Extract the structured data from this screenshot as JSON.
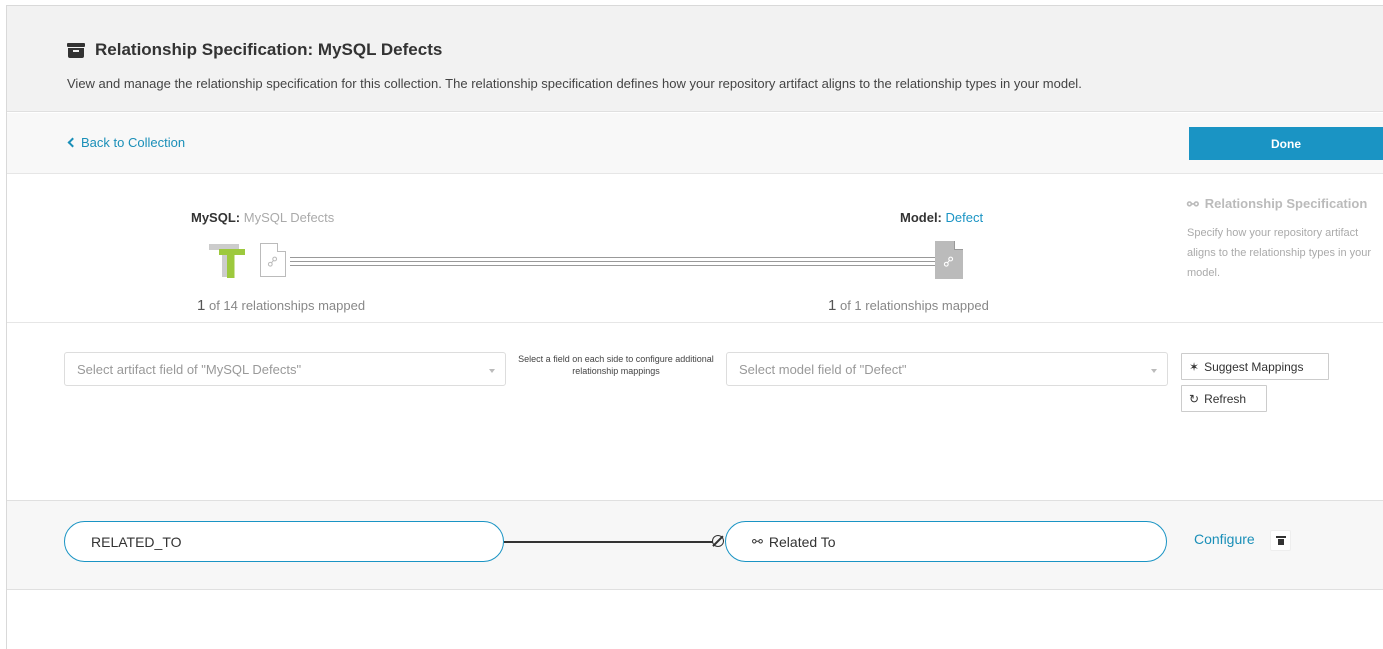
{
  "header": {
    "title": "Relationship Specification: MySQL Defects",
    "description": "View and manage the relationship specification for this collection. The relationship specification defines how your repository artifact aligns to the relationship types in your model."
  },
  "toolbar": {
    "back_label": "Back to Collection",
    "done_label": "Done"
  },
  "diagram": {
    "source": {
      "label": "MySQL:",
      "name": "MySQL Defects",
      "mapped": "1",
      "mapped_suffix": "of 14 relationships mapped"
    },
    "model": {
      "label": "Model:",
      "name": "Defect",
      "mapped": "1",
      "mapped_suffix": "of 1 relationships mapped"
    },
    "side_panel": {
      "title": "Relationship Specification",
      "description": "Specify how your repository artifact aligns to the relationship types in your model."
    }
  },
  "field_select": {
    "source_placeholder": "Select artifact field of \"MySQL Defects\"",
    "model_placeholder": "Select model field of \"Defect\"",
    "hint": "Select a field on each side to configure additional relationship mappings",
    "suggest_label": "Suggest Mappings",
    "refresh_label": "Refresh"
  },
  "mappings": [
    {
      "source_field": "RELATED_TO",
      "model_field": "Related To",
      "configure_label": "Configure"
    }
  ],
  "colors": {
    "accent": "#1a94c4",
    "link": "#1a8fb8",
    "header_bg": "#f2f2f2",
    "mapping_row_bg": "#f7f7f7"
  },
  "icons": {
    "title": "archive-icon",
    "back": "chevron-left-icon",
    "relationship": "link-icon",
    "suggest": "magic-wand-icon",
    "refresh": "refresh-icon",
    "delete": "trash-icon"
  }
}
